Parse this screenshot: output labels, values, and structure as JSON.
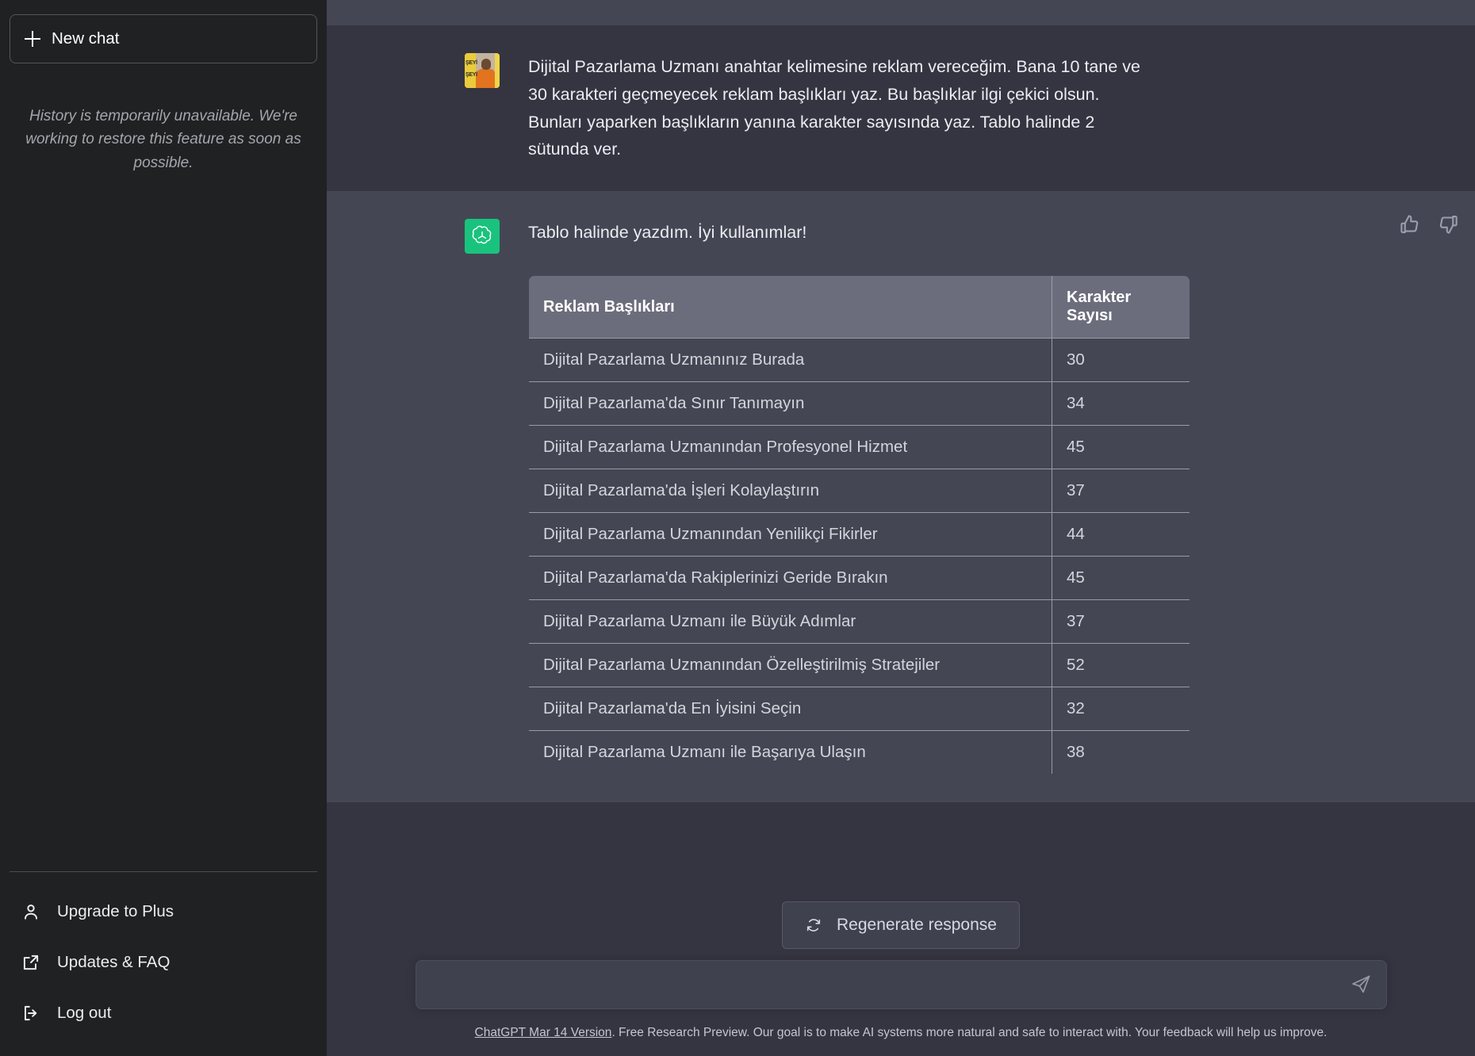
{
  "sidebar": {
    "new_chat_label": "New chat",
    "history_note": "History is temporarily unavailable. We're working to restore this feature as soon as possible.",
    "items": [
      {
        "label": "Upgrade to Plus",
        "icon": "person-icon"
      },
      {
        "label": "Updates & FAQ",
        "icon": "external-link-icon"
      },
      {
        "label": "Log out",
        "icon": "logout-icon"
      }
    ]
  },
  "conversation": {
    "user_message": "Dijital Pazarlama Uzmanı anahtar kelimesine reklam vereceğim. Bana 10 tane ve 30 karakteri geçmeyecek reklam başlıkları yaz. Bu başlıklar ilgi çekici olsun. Bunları yaparken başlıkların yanına karakter sayısında yaz. Tablo halinde 2 sütunda ver.",
    "assistant_message": "Tablo halinde yazdım. İyi kullanımlar!",
    "avatar_user_text_1": "ŞEYİ",
    "avatar_user_text_2": "ŞEYİ",
    "rate_up_label": "thumbs-up",
    "rate_down_label": "thumbs-down"
  },
  "table": {
    "columns": [
      "Reklam Başlıkları",
      "Karakter Sayısı"
    ],
    "rows": [
      [
        "Dijital Pazarlama Uzmanınız Burada",
        "30"
      ],
      [
        "Dijital Pazarlama'da Sınır Tanımayın",
        "34"
      ],
      [
        "Dijital Pazarlama Uzmanından Profesyonel Hizmet",
        "45"
      ],
      [
        "Dijital Pazarlama'da İşleri Kolaylaştırın",
        "37"
      ],
      [
        "Dijital Pazarlama Uzmanından Yenilikçi Fikirler",
        "44"
      ],
      [
        "Dijital Pazarlama'da Rakiplerinizi Geride Bırakın",
        "45"
      ],
      [
        "Dijital Pazarlama Uzmanı ile Büyük Adımlar",
        "37"
      ],
      [
        "Dijital Pazarlama Uzmanından Özelleştirilmiş Stratejiler",
        "52"
      ],
      [
        "Dijital Pazarlama'da En İyisini Seçin",
        "32"
      ],
      [
        "Dijital Pazarlama Uzmanı ile Başarıya Ulaşın",
        "38"
      ]
    ]
  },
  "composer": {
    "regenerate_label": "Regenerate response",
    "input_value": "",
    "input_placeholder": "",
    "send_icon": "send-icon"
  },
  "footer": {
    "version_link": "ChatGPT Mar 14 Version",
    "disclaimer": ". Free Research Preview. Our goal is to make AI systems more natural and safe to interact with. Your feedback will help us improve."
  },
  "colors": {
    "sidebar_bg": "#202123",
    "user_msg_bg": "#343541",
    "assistant_msg_bg": "#444654",
    "accent_green": "#19c37d",
    "table_header_bg": "#6c6d7c",
    "table_border": "#9a9ba5"
  }
}
